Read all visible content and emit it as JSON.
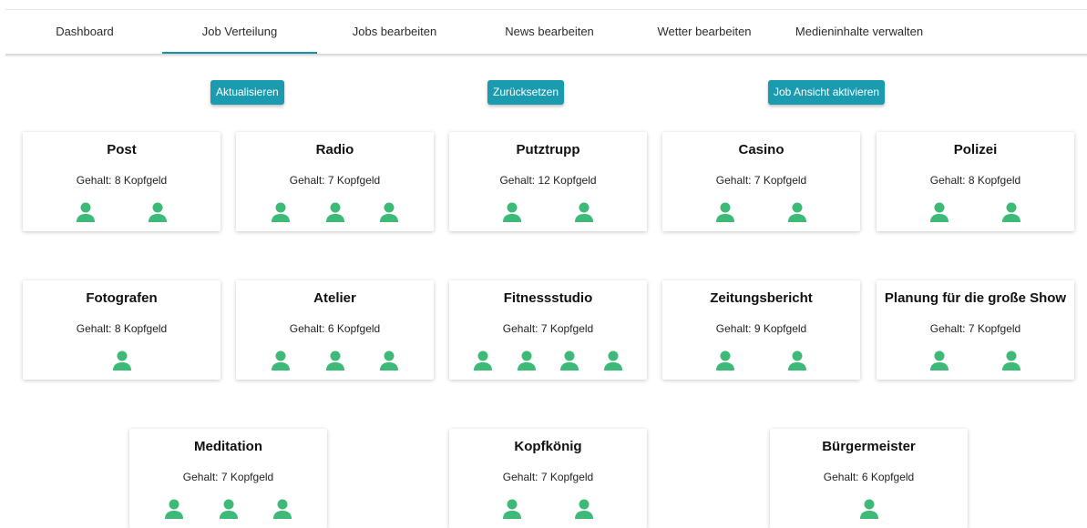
{
  "nav": {
    "tabs": [
      {
        "label": "Dashboard",
        "active": false
      },
      {
        "label": "Job Verteilung",
        "active": true
      },
      {
        "label": "Jobs bearbeiten",
        "active": false
      },
      {
        "label": "News bearbeiten",
        "active": false
      },
      {
        "label": "Wetter bearbeiten",
        "active": false
      },
      {
        "label": "Medieninhalte verwalten",
        "active": false
      }
    ]
  },
  "actions": {
    "refresh_label": "Aktualisieren",
    "reset_label": "Zurücksetzen",
    "job_view_label": "Job Ansicht aktivieren"
  },
  "jobs": [
    {
      "title": "Post",
      "salary": "Gehalt: 8 Kopfgeld",
      "workers": 2
    },
    {
      "title": "Radio",
      "salary": "Gehalt: 7 Kopfgeld",
      "workers": 3
    },
    {
      "title": "Putztrupp",
      "salary": "Gehalt: 12 Kopfgeld",
      "workers": 2
    },
    {
      "title": "Casino",
      "salary": "Gehalt: 7 Kopfgeld",
      "workers": 2
    },
    {
      "title": "Polizei",
      "salary": "Gehalt: 8 Kopfgeld",
      "workers": 2
    },
    {
      "title": "Fotografen",
      "salary": "Gehalt: 8 Kopfgeld",
      "workers": 1
    },
    {
      "title": "Atelier",
      "salary": "Gehalt: 6 Kopfgeld",
      "workers": 3
    },
    {
      "title": "Fitnessstudio",
      "salary": "Gehalt: 7 Kopfgeld",
      "workers": 4
    },
    {
      "title": "Zeitungsbericht",
      "salary": "Gehalt: 9 Kopfgeld",
      "workers": 2
    },
    {
      "title": "Planung für die große Show",
      "salary": "Gehalt: 7 Kopfgeld",
      "workers": 2
    },
    {
      "title": "Meditation",
      "salary": "Gehalt: 7 Kopfgeld",
      "workers": 3
    },
    {
      "title": "Kopfkönig",
      "salary": "Gehalt: 7 Kopfgeld",
      "workers": 2
    },
    {
      "title": "Bürgermeister",
      "salary": "Gehalt: 6 Kopfgeld",
      "workers": 1
    }
  ],
  "icons": {
    "worker": "person-icon"
  },
  "colors": {
    "accent": "#1a9bb0",
    "worker": "#3dba77",
    "tab_indicator": "#1494ab"
  }
}
